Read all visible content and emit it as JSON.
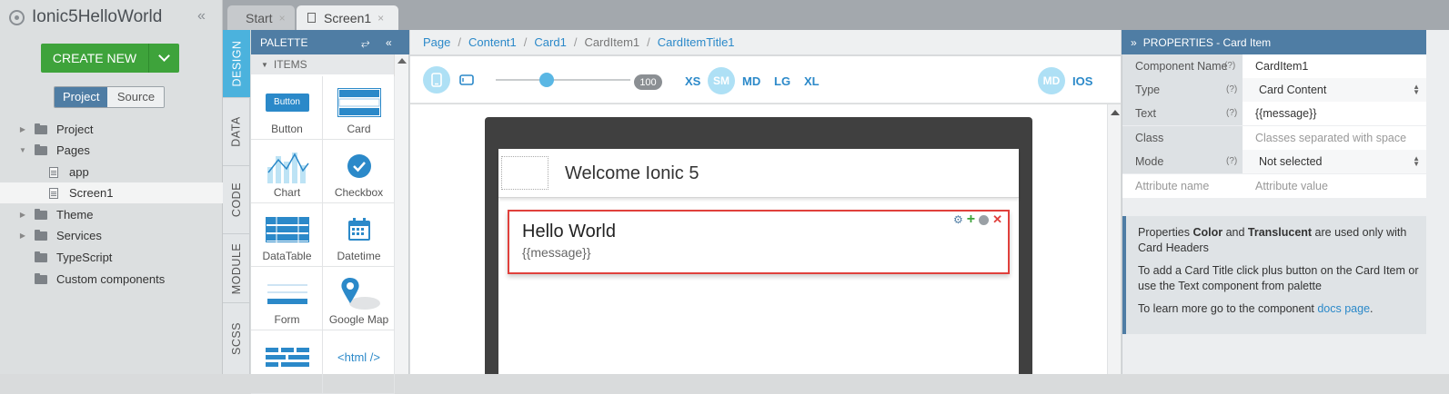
{
  "app": {
    "title": "Ionic5HelloWorld",
    "collapse_icon": "double-chevron-left-icon"
  },
  "create_new": {
    "label": "CREATE NEW"
  },
  "project_tabs": {
    "project": "Project",
    "source": "Source"
  },
  "tree": [
    {
      "label": "Project",
      "type": "folder",
      "expanded": false
    },
    {
      "label": "Pages",
      "type": "folder",
      "expanded": true
    },
    {
      "label": "app",
      "type": "file"
    },
    {
      "label": "Screen1",
      "type": "file",
      "selected": true
    },
    {
      "label": "Theme",
      "type": "folder",
      "expanded": false
    },
    {
      "label": "Services",
      "type": "folder",
      "expanded": false
    },
    {
      "label": "TypeScript",
      "type": "folder"
    },
    {
      "label": "Custom components",
      "type": "folder"
    }
  ],
  "file_tabs": [
    {
      "label": "Start",
      "close": "×"
    },
    {
      "label": "Screen1",
      "close": "×",
      "active": true
    }
  ],
  "vertical_tabs": [
    "DESIGN",
    "DATA",
    "CODE",
    "MODULE",
    "SCSS"
  ],
  "palette": {
    "title": "PALETTE",
    "section": "ITEMS",
    "items": [
      {
        "label": "Button",
        "icon_text": "Button"
      },
      {
        "label": "Card"
      },
      {
        "label": "Chart"
      },
      {
        "label": "Checkbox"
      },
      {
        "label": "DataTable"
      },
      {
        "label": "Datetime"
      },
      {
        "label": "Form"
      },
      {
        "label": "Google Map"
      },
      {
        "label": ""
      },
      {
        "label": "",
        "icon_text": "<html />"
      }
    ]
  },
  "breadcrumb": [
    "Page",
    "Content1",
    "Card1",
    "CardItem1",
    "CardItemTitle1"
  ],
  "toolbar": {
    "zoom": "100",
    "zoom_fraction": 0.38,
    "breakpoints": [
      "XS",
      "SM",
      "MD",
      "LG",
      "XL"
    ],
    "active_breakpoint": "SM",
    "mode": "MD",
    "platform": "IOS"
  },
  "preview": {
    "header_title": "Welcome Ionic 5",
    "card_title": "Hello World",
    "card_text": "{{message}}"
  },
  "properties": {
    "title": "PROPERTIES - Card Item",
    "rows": [
      {
        "key": "Component Name",
        "help": "(?)",
        "value": "CardItem1"
      },
      {
        "key": "Type",
        "help": "(?)",
        "value": "Card Content",
        "select": true
      },
      {
        "key": "Text",
        "help": "(?)",
        "value": "{{message}}"
      },
      {
        "key": "Class",
        "help": "",
        "value": "Classes separated with space",
        "placeholder": true
      },
      {
        "key": "Mode",
        "help": "(?)",
        "value": "Not selected",
        "select": true
      },
      {
        "key": "Attribute name",
        "help": "",
        "value": "Attribute value",
        "placeholder": true
      }
    ],
    "info_1_pre": "Properties ",
    "info_1_b1": "Color",
    "info_1_mid": " and ",
    "info_1_b2": "Translucent",
    "info_1_post": " are used only with Card Headers",
    "info_2": "To add a Card Title click plus button on the Card Item or use the Text component from palette",
    "info_3_pre": "To learn more go to the component ",
    "info_3_link": "docs page",
    "info_3_post": "."
  },
  "colors": {
    "accent": "#4f7da4",
    "create_green": "#3ea33b",
    "link": "#2b89c9",
    "selection_red": "#e0403c"
  }
}
